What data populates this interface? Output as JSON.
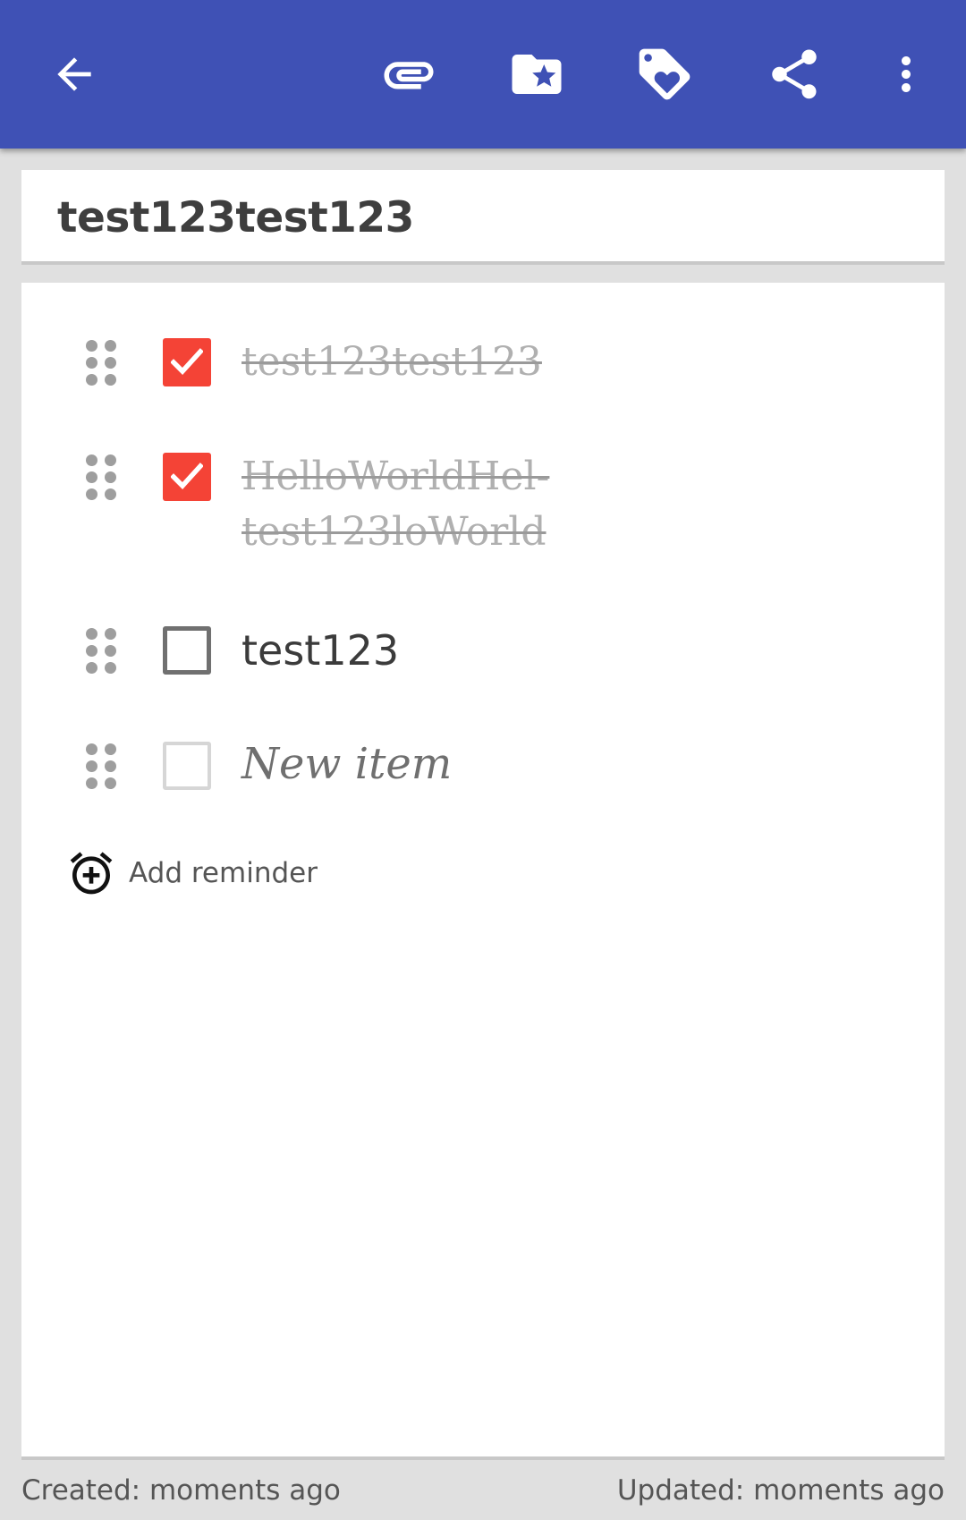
{
  "toolbar": {
    "icons": [
      "back-arrow-icon",
      "attachment-icon",
      "category-folder-star-icon",
      "tag-icon",
      "share-icon",
      "more-vert-icon"
    ],
    "color": "#3f51b5"
  },
  "note": {
    "title": "test123test123"
  },
  "checklist": {
    "items": [
      {
        "text": "test123test123",
        "checked": true
      },
      {
        "text": "HelloWorldHel-\ntest123loWorld",
        "checked": true
      },
      {
        "text": "test123",
        "checked": false
      }
    ],
    "new_item_placeholder": "New item",
    "check_color": "#f44336"
  },
  "reminder": {
    "label": "Add reminder"
  },
  "footer": {
    "created": "Created: moments ago",
    "updated": "Updated: moments ago"
  }
}
